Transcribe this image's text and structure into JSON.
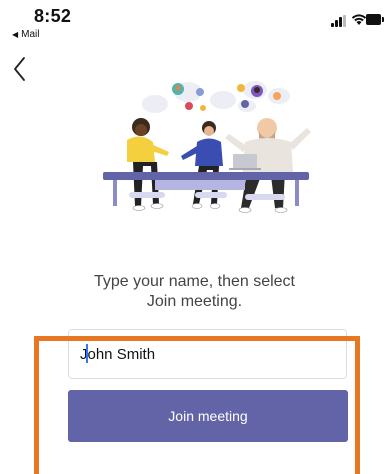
{
  "status_bar": {
    "time": "8:52",
    "back_app_label": "Mail",
    "icons": [
      "signal-icon",
      "wifi-icon",
      "battery-icon"
    ]
  },
  "nav": {
    "back_icon": "chevron-left-icon"
  },
  "join": {
    "prompt_line1": "Type your name, then select",
    "prompt_line2": "Join meeting.",
    "name_value": "John Smith",
    "button_label": "Join meeting"
  },
  "colors": {
    "accent": "#6264a7",
    "highlight": "#e87722",
    "caret": "#3478f6"
  }
}
